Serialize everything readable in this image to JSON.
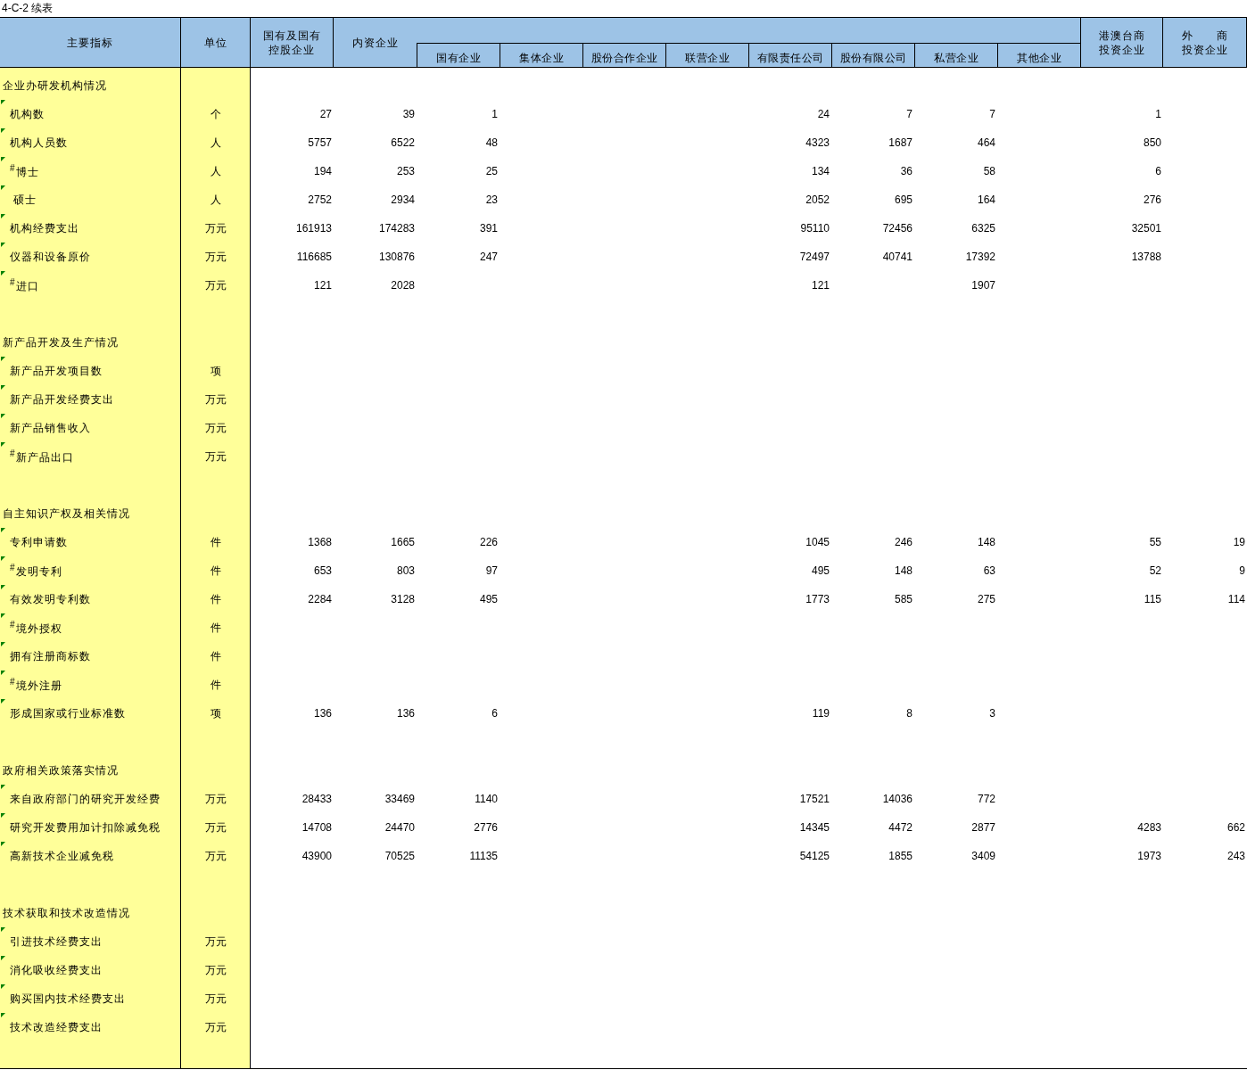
{
  "sheet_title": "4-C-2 续表",
  "header": {
    "indicator": "主要指标",
    "unit": "单位",
    "state_holding": [
      "国有及国有",
      "控股企业"
    ],
    "domestic": "内资企业",
    "domestic_sub": [
      "国有企业",
      "集体企业",
      "股份合作企业",
      "联营企业",
      "有限责任公司",
      "股份有限公司",
      "私营企业",
      "其他企业"
    ],
    "hk_macao_taiwan": [
      "港澳台商",
      "投资企业"
    ],
    "foreign": [
      "外　　商",
      "投资企业"
    ]
  },
  "rows": [
    {
      "kind": "section",
      "label": "企业办研发机构情况"
    },
    {
      "kind": "item",
      "flagged": true,
      "label": "机构数",
      "unit": "个",
      "values": {
        "state_holding": "27",
        "domestic": "39",
        "state_owned": "1",
        "limited_liability": "24",
        "joint_stock": "7",
        "private": "7",
        "hk_macao_taiwan": "1"
      }
    },
    {
      "kind": "item",
      "flagged": true,
      "label": "机构人员数",
      "unit": "人",
      "values": {
        "state_holding": "5757",
        "domestic": "6522",
        "state_owned": "48",
        "limited_liability": "4323",
        "joint_stock": "1687",
        "private": "464",
        "hk_macao_taiwan": "850"
      }
    },
    {
      "kind": "item",
      "flagged": true,
      "label": "$^{#}$博士",
      "unit": "人",
      "values": {
        "state_holding": "194",
        "domestic": "253",
        "state_owned": "25",
        "limited_liability": "134",
        "joint_stock": "36",
        "private": "58",
        "hk_macao_taiwan": "6"
      }
    },
    {
      "kind": "item",
      "flagged": true,
      "label": " 硕士",
      "unit": "人",
      "values": {
        "state_holding": "2752",
        "domestic": "2934",
        "state_owned": "23",
        "limited_liability": "2052",
        "joint_stock": "695",
        "private": "164",
        "hk_macao_taiwan": "276"
      }
    },
    {
      "kind": "item",
      "flagged": true,
      "label": "机构经费支出",
      "unit": "万元",
      "values": {
        "state_holding": "161913",
        "domestic": "174283",
        "state_owned": "391",
        "limited_liability": "95110",
        "joint_stock": "72456",
        "private": "6325",
        "hk_macao_taiwan": "32501"
      }
    },
    {
      "kind": "item",
      "flagged": true,
      "label": "仪器和设备原价",
      "unit": "万元",
      "values": {
        "state_holding": "116685",
        "domestic": "130876",
        "state_owned": "247",
        "limited_liability": "72497",
        "joint_stock": "40741",
        "private": "17392",
        "hk_macao_taiwan": "13788"
      }
    },
    {
      "kind": "item",
      "flagged": true,
      "label": "$^{#}$进口",
      "unit": "万元",
      "values": {
        "state_holding": "121",
        "domestic": "2028",
        "limited_liability": "121",
        "private": "1907"
      }
    },
    {
      "kind": "blank"
    },
    {
      "kind": "section",
      "label": "新产品开发及生产情况"
    },
    {
      "kind": "item",
      "flagged": true,
      "label": "新产品开发项目数",
      "unit": "项"
    },
    {
      "kind": "item",
      "flagged": true,
      "label": "新产品开发经费支出",
      "unit": "万元"
    },
    {
      "kind": "item",
      "flagged": true,
      "label": "新产品销售收入",
      "unit": "万元"
    },
    {
      "kind": "item",
      "flagged": true,
      "label": "$^{#}$新产品出口",
      "unit": "万元"
    },
    {
      "kind": "blank"
    },
    {
      "kind": "section",
      "label": "自主知识产权及相关情况"
    },
    {
      "kind": "item",
      "flagged": true,
      "label": "专利申请数",
      "unit": "件",
      "values": {
        "state_holding": "1368",
        "domestic": "1665",
        "state_owned": "226",
        "limited_liability": "1045",
        "joint_stock": "246",
        "private": "148",
        "hk_macao_taiwan": "55",
        "foreign": "19"
      }
    },
    {
      "kind": "item",
      "flagged": true,
      "label": "$^{#}$发明专利",
      "unit": "件",
      "values": {
        "state_holding": "653",
        "domestic": "803",
        "state_owned": "97",
        "limited_liability": "495",
        "joint_stock": "148",
        "private": "63",
        "hk_macao_taiwan": "52",
        "foreign": "9"
      }
    },
    {
      "kind": "item",
      "flagged": true,
      "label": "有效发明专利数",
      "unit": "件",
      "values": {
        "state_holding": "2284",
        "domestic": "3128",
        "state_owned": "495",
        "limited_liability": "1773",
        "joint_stock": "585",
        "private": "275",
        "hk_macao_taiwan": "115",
        "foreign": "114"
      }
    },
    {
      "kind": "item",
      "flagged": true,
      "label": "$^{#}$境外授权",
      "unit": "件"
    },
    {
      "kind": "item",
      "flagged": true,
      "label": "拥有注册商标数",
      "unit": "件"
    },
    {
      "kind": "item",
      "flagged": true,
      "label": "$^{#}$境外注册",
      "unit": "件"
    },
    {
      "kind": "item",
      "flagged": true,
      "label": "形成国家或行业标准数",
      "unit": "项",
      "values": {
        "state_holding": "136",
        "domestic": "136",
        "state_owned": "6",
        "limited_liability": "119",
        "joint_stock": "8",
        "private": "3"
      }
    },
    {
      "kind": "blank"
    },
    {
      "kind": "section",
      "label": "政府相关政策落实情况"
    },
    {
      "kind": "item",
      "flagged": true,
      "label": "来自政府部门的研究开发经费",
      "unit": "万元",
      "values": {
        "state_holding": "28433",
        "domestic": "33469",
        "state_owned": "1140",
        "limited_liability": "17521",
        "joint_stock": "14036",
        "private": "772"
      }
    },
    {
      "kind": "item",
      "flagged": true,
      "label": "研究开发费用加计扣除减免税",
      "unit": "万元",
      "values": {
        "state_holding": "14708",
        "domestic": "24470",
        "state_owned": "2776",
        "limited_liability": "14345",
        "joint_stock": "4472",
        "private": "2877",
        "hk_macao_taiwan": "4283",
        "foreign": "662"
      }
    },
    {
      "kind": "item",
      "flagged": true,
      "label": "高新技术企业减免税",
      "unit": "万元",
      "values": {
        "state_holding": "43900",
        "domestic": "70525",
        "state_owned": "11135",
        "limited_liability": "54125",
        "joint_stock": "1855",
        "private": "3409",
        "hk_macao_taiwan": "1973",
        "foreign": "243"
      }
    },
    {
      "kind": "blank"
    },
    {
      "kind": "section",
      "label": "技术获取和技术改造情况"
    },
    {
      "kind": "item",
      "flagged": true,
      "label": "引进技术经费支出",
      "unit": "万元"
    },
    {
      "kind": "item",
      "flagged": true,
      "label": "消化吸收经费支出",
      "unit": "万元"
    },
    {
      "kind": "item",
      "flagged": true,
      "label": "购买国内技术经费支出",
      "unit": "万元"
    },
    {
      "kind": "item",
      "flagged": true,
      "label": "技术改造经费支出",
      "unit": "万元"
    }
  ]
}
